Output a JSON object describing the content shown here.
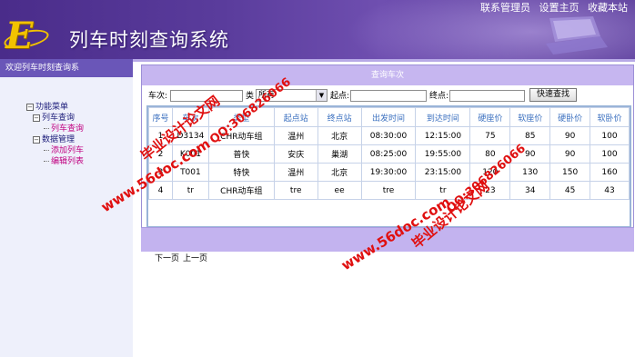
{
  "header": {
    "title": "列车时刻查询系统",
    "top_links": [
      "联系管理员",
      "设置主页",
      "收藏本站"
    ]
  },
  "subbar": {
    "welcome": "欢迎列车时刻查询系"
  },
  "nav": {
    "root": "功能菜单",
    "groups": [
      {
        "label": "列车查询",
        "items": [
          "列车查询"
        ]
      },
      {
        "label": "数据管理",
        "items": [
          "添加列车",
          "编辑列表"
        ]
      }
    ]
  },
  "panel": {
    "title": "查询车次",
    "search": {
      "train_label": "车次:",
      "train_value": "",
      "type_label": "类",
      "type_value": "所有",
      "from_label": "起点:",
      "from_value": "",
      "to_label": "终点:",
      "to_value": "",
      "button": "快速查找"
    },
    "table": {
      "headers": [
        "序号",
        "车次",
        "类型",
        "起点站",
        "终点站",
        "出发时间",
        "到达时间",
        "硬座价",
        "软座价",
        "硬卧价",
        "软卧价"
      ],
      "rows": [
        [
          "1",
          "D3134",
          "CHR动车组",
          "温州",
          "北京",
          "08:30:00",
          "12:15:00",
          "75",
          "85",
          "90",
          "100"
        ],
        [
          "2",
          "K001",
          "普快",
          "安庆",
          "巢湖",
          "08:25:00",
          "19:55:00",
          "80",
          "90",
          "90",
          "100"
        ],
        [
          "3",
          "T001",
          "特快",
          "温州",
          "北京",
          "19:30:00",
          "23:15:00",
          "120",
          "130",
          "150",
          "160"
        ],
        [
          "4",
          "tr",
          "CHR动车组",
          "tre",
          "ee",
          "tre",
          "tr",
          "23",
          "34",
          "45",
          "43"
        ]
      ]
    },
    "pager": {
      "next": "下一页",
      "prev": "上一页"
    }
  },
  "watermarks": {
    "site": "www.56doc.com",
    "qq": "QQ:306826066",
    "brand": "毕业设计论文网"
  },
  "colors": {
    "header_bg": "#4a2c8a",
    "panel_title_bg": "#c6b6f0",
    "nav_bg": "#eef0fb",
    "watermark": "#e01010"
  }
}
